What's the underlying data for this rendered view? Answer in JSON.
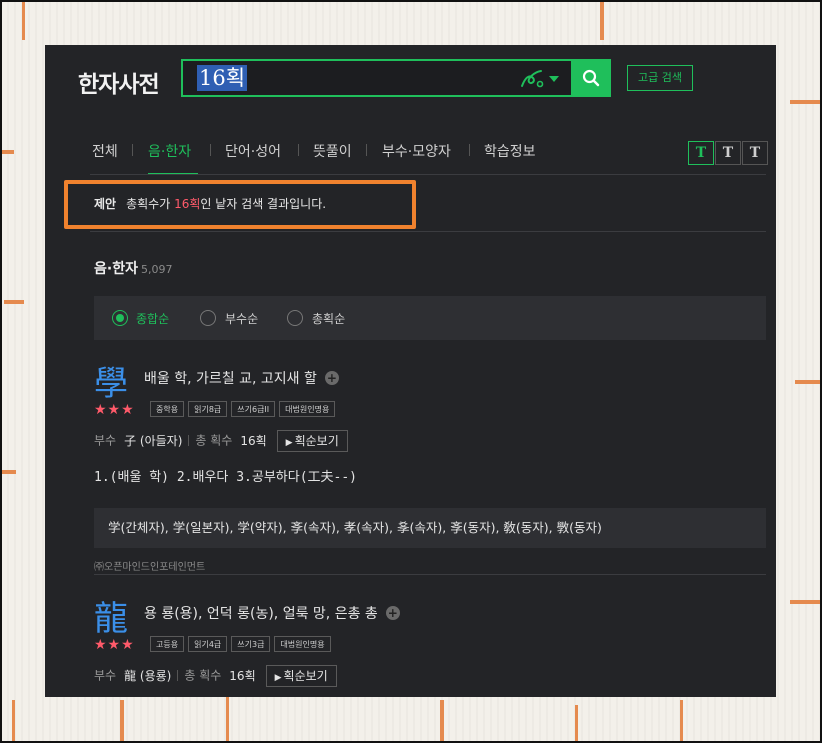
{
  "header": {
    "logo": "한자사전",
    "search_value": "16획",
    "advanced_label": "고급 검색"
  },
  "tabs": [
    {
      "label": "전체",
      "active": false
    },
    {
      "label": "음·한자",
      "active": true
    },
    {
      "label": "단어·성어",
      "active": false
    },
    {
      "label": "뜻풀이",
      "active": false
    },
    {
      "label": "부수·모양자",
      "active": false
    },
    {
      "label": "학습정보",
      "active": false
    }
  ],
  "font_size_buttons": [
    "T",
    "T",
    "T"
  ],
  "suggestion": {
    "label": "제안",
    "prefix": "총획수가",
    "highlight": "16획",
    "suffix": "인 낱자 검색 결과입니다."
  },
  "section": {
    "title": "음·한자",
    "count": "5,097"
  },
  "sort": {
    "options": [
      "종합순",
      "부수순",
      "총획순"
    ],
    "selected": "종합순"
  },
  "entries": [
    {
      "hanja": "學",
      "meaning": "배울 학, 가르칠 교, 고지새 할",
      "stars": "★★★",
      "badges": [
        "중학용",
        "읽기8급",
        "쓰기6급II",
        "대법원인명용"
      ],
      "radical_label": "부수",
      "radical": "子 (아들자)",
      "strokes_label": "총 획수",
      "strokes": "16획",
      "stroke_btn": "획순보기",
      "definitions": "1.(배울 학) 2.배우다 3.공부하다(工夫--)",
      "variants": "学(간체자), 学(일본자), 学(약자), 斈(속자), 孝(속자), 𡥈(속자), 斈(동자), 敎(동자), 斆(동자)",
      "source": "㈜오픈마인드인포테인먼트"
    },
    {
      "hanja": "龍",
      "meaning": "용 룡(용), 언덕 롱(농), 얼룩 망, 은총 총",
      "stars": "★★★",
      "badges": [
        "고등용",
        "읽기4급",
        "쓰기3급",
        "대법원인명용"
      ],
      "radical_label": "부수",
      "radical": "龍 (용룡)",
      "strokes_label": "총 획수",
      "strokes": "16획",
      "stroke_btn": "획순보기"
    }
  ]
}
